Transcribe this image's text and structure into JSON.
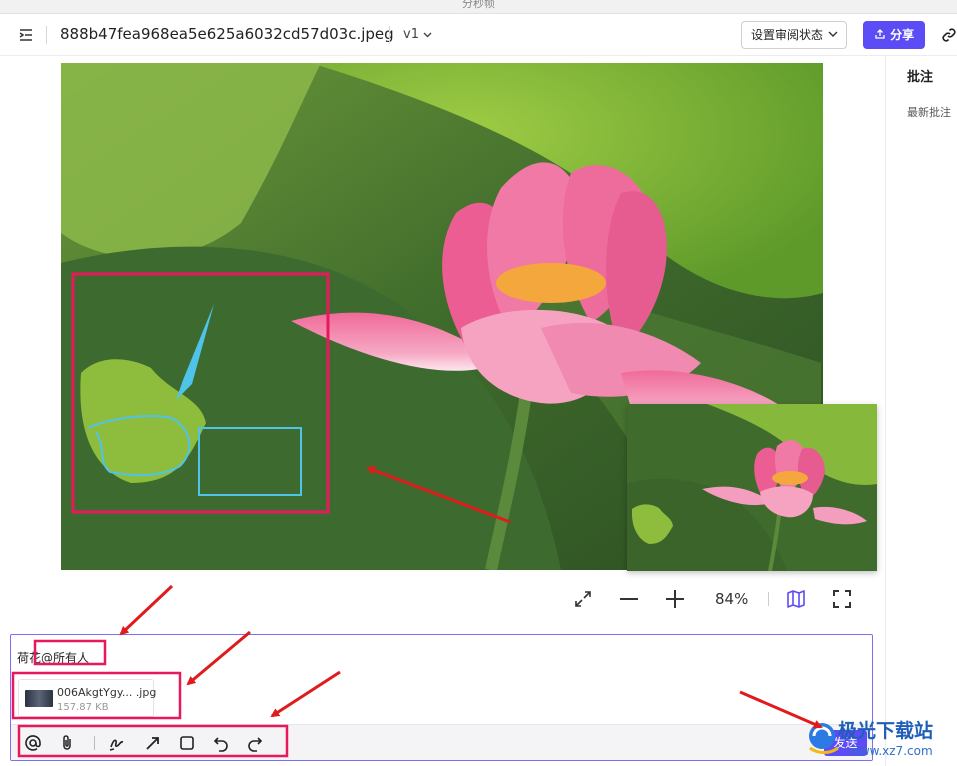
{
  "app": {
    "title": "分秒帧"
  },
  "header": {
    "filename": "888b47fea968ea5e625a6032cd57d03c.jpeg",
    "version": "v1",
    "review_label": "设置审阅状态",
    "share_label": "分享"
  },
  "sidebar": {
    "title": "批注",
    "subtitle": "最新批注"
  },
  "viewer": {
    "zoom": "84%"
  },
  "composer": {
    "text": "荷花@所有人",
    "attachment": {
      "name": "006AkgtYgy... .jpg",
      "size": "157.87 KB"
    },
    "send_label": "发送"
  },
  "watermark": {
    "line1": "极光下载站",
    "line2": "www.xz7.com"
  },
  "colors": {
    "accent": "#5b4cf5",
    "callout_red": "#e8185a",
    "arrow_red": "#e01b1b",
    "annot_blue": "#4fc3ea"
  }
}
